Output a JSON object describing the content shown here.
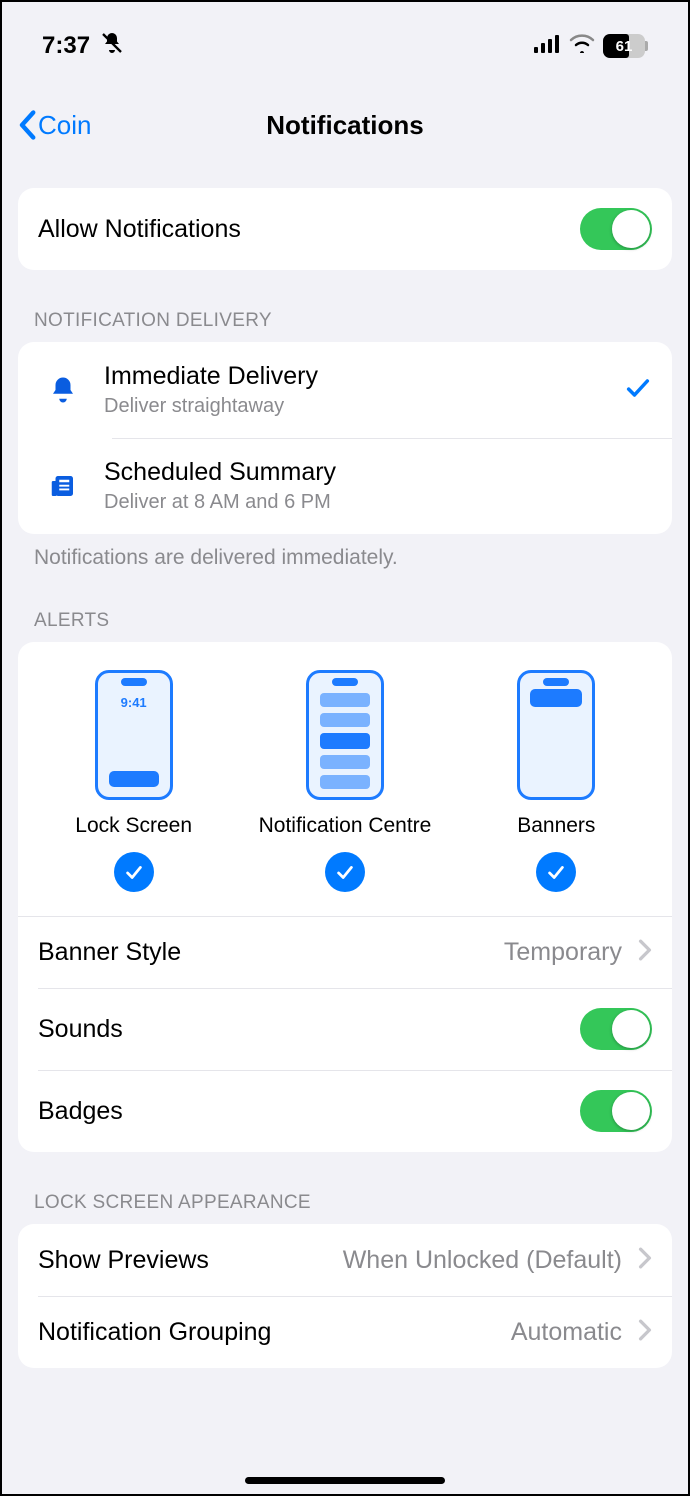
{
  "status": {
    "time": "7:37",
    "battery_pct": "61"
  },
  "nav": {
    "back_label": "Coin",
    "title": "Notifications"
  },
  "allow": {
    "label": "Allow Notifications",
    "on": true
  },
  "delivery": {
    "header": "NOTIFICATION DELIVERY",
    "footer": "Notifications are delivered immediately.",
    "items": [
      {
        "title": "Immediate Delivery",
        "sub": "Deliver straightaway",
        "selected": true
      },
      {
        "title": "Scheduled Summary",
        "sub": "Deliver at 8 AM and 6 PM",
        "selected": false
      }
    ]
  },
  "alerts": {
    "header": "ALERTS",
    "types": [
      {
        "label": "Lock Screen",
        "checked": true,
        "preview_time": "9:41"
      },
      {
        "label": "Notification Centre",
        "checked": true
      },
      {
        "label": "Banners",
        "checked": true
      }
    ],
    "banner_style": {
      "label": "Banner Style",
      "value": "Temporary"
    },
    "sounds": {
      "label": "Sounds",
      "on": true
    },
    "badges": {
      "label": "Badges",
      "on": true
    }
  },
  "lockscreen": {
    "header": "LOCK SCREEN APPEARANCE",
    "previews": {
      "label": "Show Previews",
      "value": "When Unlocked (Default)"
    },
    "grouping": {
      "label": "Notification Grouping",
      "value": "Automatic"
    }
  }
}
